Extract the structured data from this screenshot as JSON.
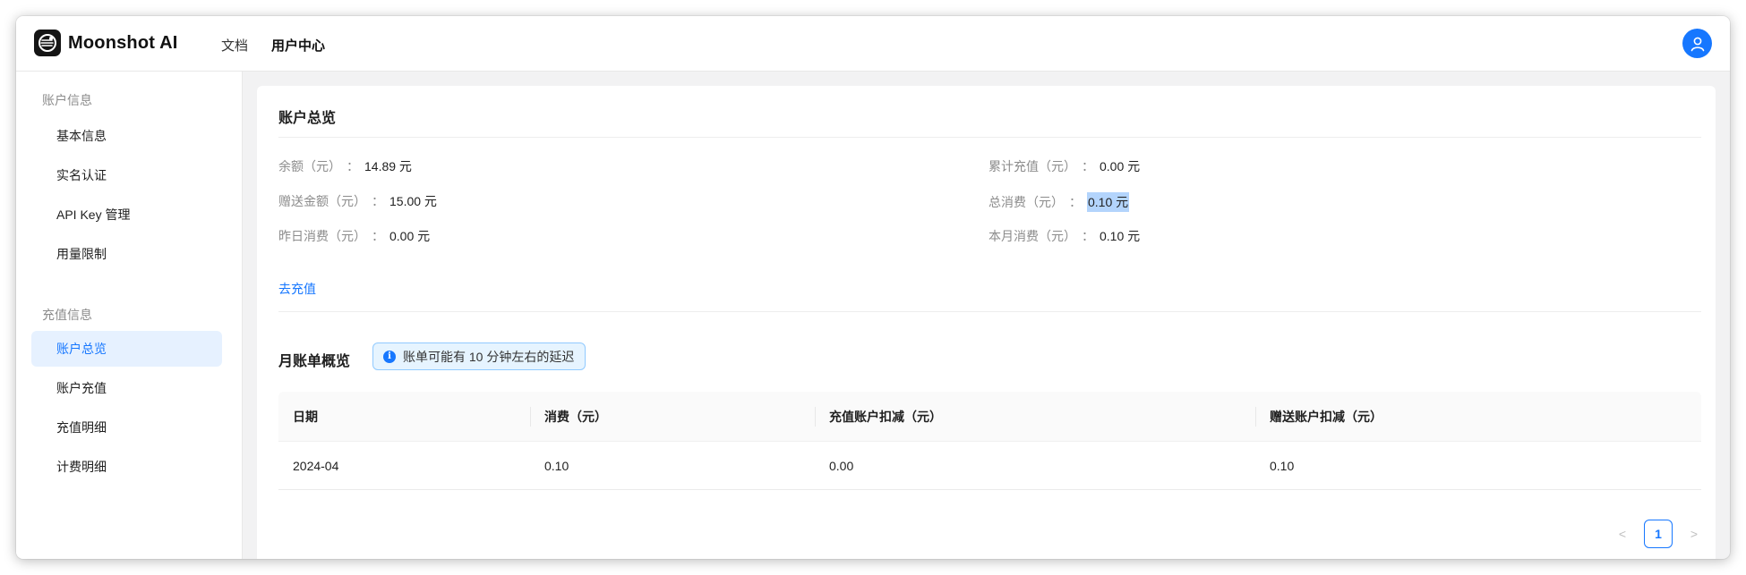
{
  "app": {
    "brand": "Moonshot AI"
  },
  "topnav": [
    {
      "label": "文档",
      "active": false
    },
    {
      "label": "用户中心",
      "active": true
    }
  ],
  "sidebar": {
    "groups": [
      {
        "title": "账户信息",
        "items": [
          "基本信息",
          "实名认证",
          "API Key 管理",
          "用量限制"
        ]
      },
      {
        "title": "充值信息",
        "items": [
          "账户总览",
          "账户充值",
          "充值明细",
          "计费明细"
        ]
      }
    ],
    "active_item": "账户总览"
  },
  "overview": {
    "title": "账户总览",
    "colon": "：",
    "left": [
      {
        "label": "余额（元）",
        "value": "14.89 元"
      },
      {
        "label": "赠送金额（元）",
        "value": "15.00 元"
      },
      {
        "label": "昨日消费（元）",
        "value": "0.00 元"
      }
    ],
    "right": [
      {
        "label": "累计充值（元）",
        "value": "0.00 元"
      },
      {
        "label": "总消费（元）",
        "value": "0.10 元"
      },
      {
        "label": "本月消费（元）",
        "value": "0.10 元"
      }
    ],
    "recharge_link": "去充值"
  },
  "monthly": {
    "title": "月账单概览",
    "notice": "账单可能有 10 分钟左右的延迟",
    "columns": [
      "日期",
      "消费（元）",
      "充值账户扣减（元）",
      "赠送账户扣减（元）"
    ],
    "rows": [
      [
        "2024-04",
        "0.10",
        "0.00",
        "0.10"
      ]
    ]
  },
  "pagination": {
    "current": "1",
    "prev": "<",
    "next": ">"
  },
  "colors": {
    "accent": "#1677ff",
    "selection": "#b3d4fc"
  }
}
